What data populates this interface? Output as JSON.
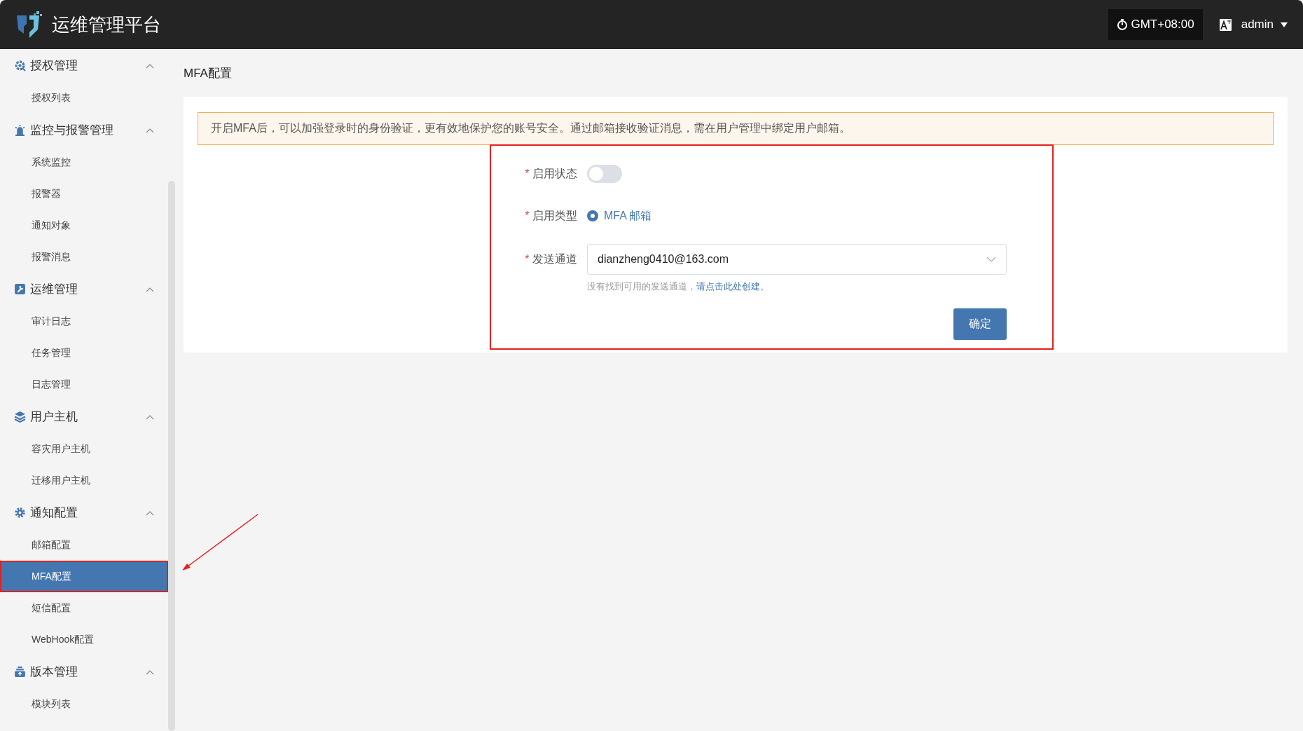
{
  "header": {
    "title": "运维管理平台",
    "timezone": "GMT+08:00",
    "user": "admin"
  },
  "sidebar": {
    "groups": [
      {
        "label": "授权管理",
        "expanded": true,
        "items": [
          {
            "label": "授权列表",
            "selected": false
          }
        ]
      },
      {
        "label": "监控与报警管理",
        "expanded": true,
        "items": [
          {
            "label": "系统监控",
            "selected": false
          },
          {
            "label": "报警器",
            "selected": false
          },
          {
            "label": "通知对象",
            "selected": false
          },
          {
            "label": "报警消息",
            "selected": false
          }
        ]
      },
      {
        "label": "运维管理",
        "expanded": true,
        "items": [
          {
            "label": "审计日志",
            "selected": false
          },
          {
            "label": "任务管理",
            "selected": false
          },
          {
            "label": "日志管理",
            "selected": false
          }
        ]
      },
      {
        "label": "用户主机",
        "expanded": true,
        "items": [
          {
            "label": "容灾用户主机",
            "selected": false
          },
          {
            "label": "迁移用户主机",
            "selected": false
          }
        ]
      },
      {
        "label": "通知配置",
        "expanded": true,
        "items": [
          {
            "label": "邮箱配置",
            "selected": false
          },
          {
            "label": "MFA配置",
            "selected": true
          },
          {
            "label": "短信配置",
            "selected": false
          },
          {
            "label": "WebHook配置",
            "selected": false
          }
        ]
      },
      {
        "label": "版本管理",
        "expanded": true,
        "items": [
          {
            "label": "模块列表",
            "selected": false
          }
        ]
      }
    ]
  },
  "page_title": "MFA配置",
  "alert": "开启MFA后，可以加强登录时的身份验证，更有效地保护您的账号安全。通过邮箱接收验证消息，需在用户管理中绑定用户邮箱。",
  "form": {
    "status": {
      "required_mark": "*",
      "label": "启用状态",
      "on": false
    },
    "type": {
      "required_mark": "*",
      "label": "启用类型",
      "options": [
        {
          "label": "MFA 邮箱",
          "selected": true
        }
      ]
    },
    "channel": {
      "required_mark": "*",
      "label": "发送通道",
      "value": "dianzheng0410@163.com",
      "hint": "没有找到可用的发送通道，",
      "hint_link": "请点击此处创建。"
    },
    "submit": "确定"
  }
}
